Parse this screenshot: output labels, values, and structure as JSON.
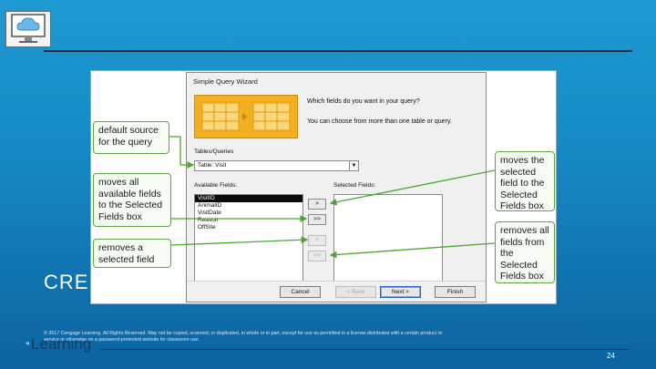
{
  "slide": {
    "title": "CRE",
    "copyright": "© 2017 Cengage Learning. All Rights Reserved. May not be copied, scanned, or duplicated, in whole or in part, except for use as permitted in a license distributed with a certain product or service or otherwise on a password-protected website for classroom use.",
    "brand": "Learning",
    "page_number": "24",
    "colors": {
      "background": "#1587c2",
      "rule": "#1a2b3a",
      "callout_border": "#5fa545",
      "arrow": "#4aa832"
    }
  },
  "wizard": {
    "title": "Simple Query Wizard",
    "question": "Which fields do you want in your query?",
    "hint": "You can choose from more than one table or query.",
    "tables_queries_label": "Tables/Queries",
    "tables_queries_value": "Table: Visit",
    "available_fields_label": "Available Fields:",
    "selected_fields_label": "Selected Fields:",
    "available_fields": [
      "VisitID",
      "AnimalID",
      "VisitDate",
      "Reason",
      "OffSite"
    ],
    "selected_fields": [],
    "buttons": {
      "move_one": ">",
      "move_all": ">>",
      "remove_one": "<",
      "remove_all": "<<",
      "cancel": "Cancel",
      "back": "< Back",
      "next": "Next >",
      "finish": "Finish"
    }
  },
  "callouts": {
    "default_source": "default source for the query",
    "moves_all_available": "moves all available fields to the Selected Fields box",
    "removes_selected": "removes a selected field",
    "moves_selected": "moves the selected field to the Selected Fields box",
    "removes_all": "removes all fields from the Selected Fields box"
  }
}
